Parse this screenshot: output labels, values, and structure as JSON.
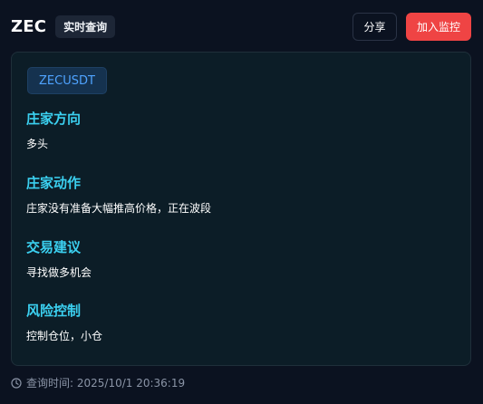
{
  "header": {
    "symbol": "ZEC",
    "badge": "实时查询",
    "share_label": "分享",
    "monitor_label": "加入监控"
  },
  "card": {
    "pair": "ZECUSDT",
    "sections": [
      {
        "title": "庄家方向",
        "text": "多头"
      },
      {
        "title": "庄家动作",
        "text": "庄家没有准备大幅推高价格，正在波段"
      },
      {
        "title": "交易建议",
        "text": "寻找做多机会"
      },
      {
        "title": "风险控制",
        "text": "控制仓位，小仓"
      }
    ]
  },
  "footer": {
    "icon": "clock-icon",
    "query_time": "查询时间: 2025/10/1 20:36:19"
  },
  "colors": {
    "background": "#0b1220",
    "card_background": "#0c1d27",
    "section_title": "#3bd0f0",
    "pair_chip_text": "#4fa3ff",
    "monitor_button": "#ef4444"
  }
}
